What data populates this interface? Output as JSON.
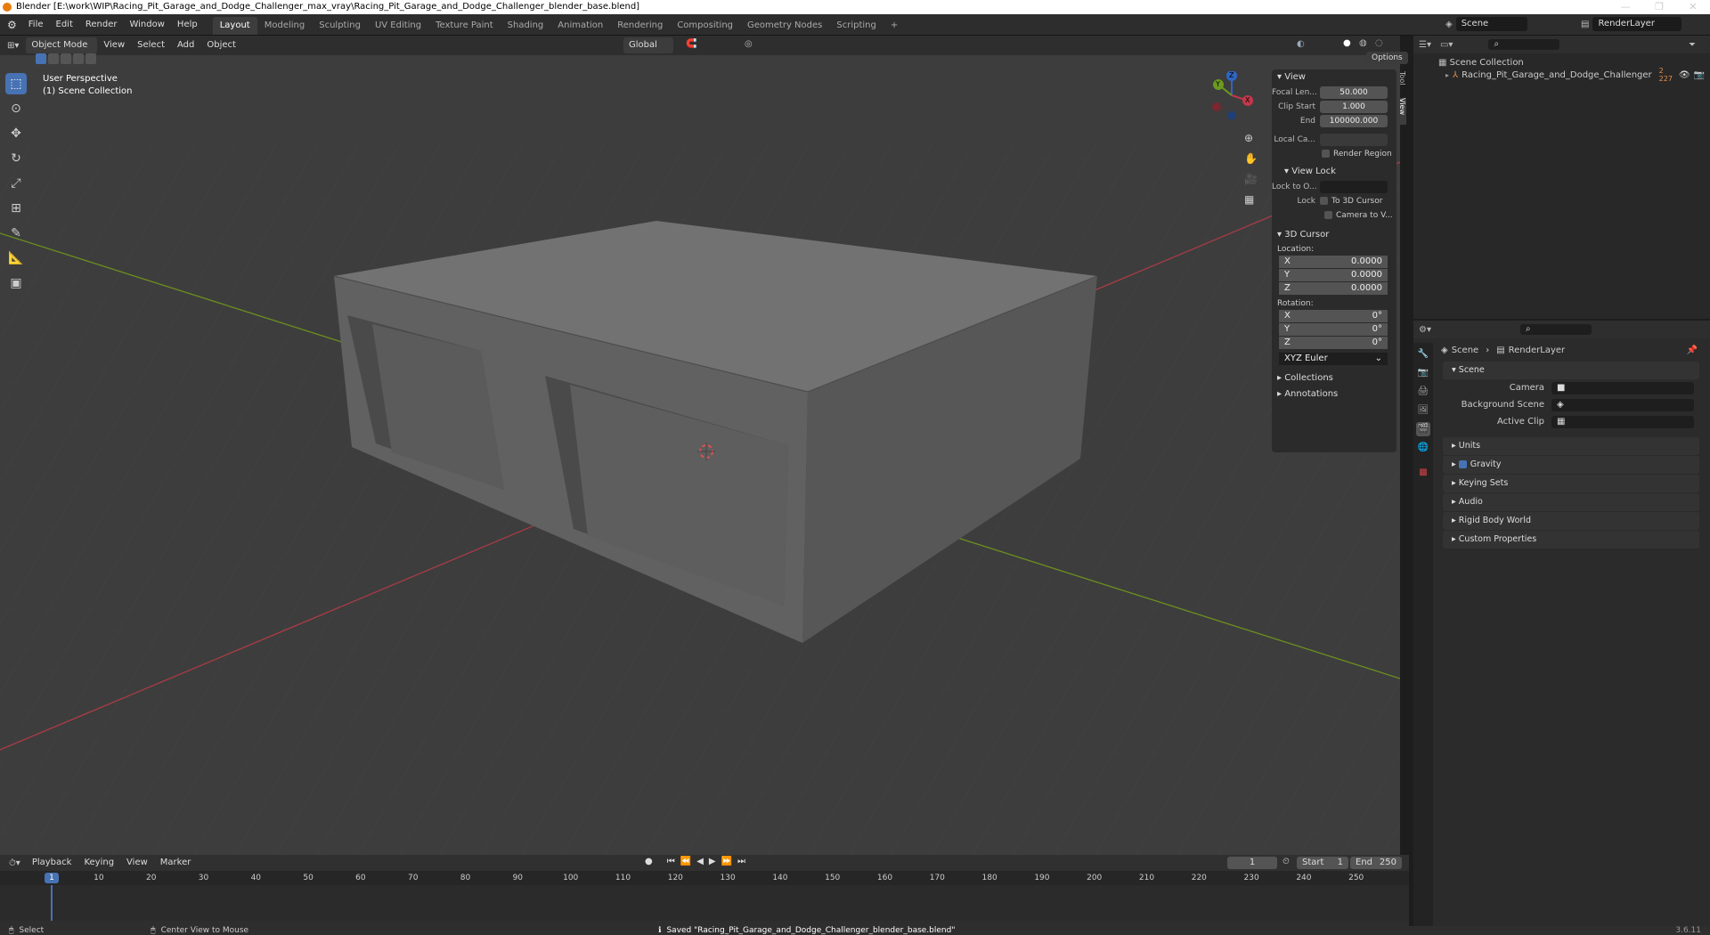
{
  "title_bar": {
    "title": "Blender [E:\\work\\WIP\\Racing_Pit_Garage_and_Dodge_Challenger_max_vray\\Racing_Pit_Garage_and_Dodge_Challenger_blender_base.blend]",
    "controls": [
      "—",
      "❐",
      "✕"
    ]
  },
  "menus": [
    "File",
    "Edit",
    "Render",
    "Window",
    "Help"
  ],
  "workspaces": [
    {
      "label": "Layout",
      "active": true
    },
    {
      "label": "Modeling"
    },
    {
      "label": "Sculpting"
    },
    {
      "label": "UV Editing"
    },
    {
      "label": "Texture Paint"
    },
    {
      "label": "Shading"
    },
    {
      "label": "Animation"
    },
    {
      "label": "Rendering"
    },
    {
      "label": "Compositing"
    },
    {
      "label": "Geometry Nodes"
    },
    {
      "label": "Scripting"
    }
  ],
  "add_workspace": "+",
  "scene_name": "Scene",
  "view_layer_name": "RenderLayer",
  "viewport_header": {
    "mode": "Object Mode",
    "menus": [
      "View",
      "Select",
      "Add",
      "Object"
    ],
    "transform_orientation": "Global",
    "options_label": "Options"
  },
  "viewport": {
    "perspective": "User Perspective",
    "collection": "(1) Scene Collection",
    "background": "#3d3d3d",
    "axis_x_color": "#a83c45",
    "axis_y_color": "#6c8f1f"
  },
  "gizmo": {
    "x": "X",
    "y": "Y",
    "z": "Z"
  },
  "tools": [
    {
      "icon": "select-box-icon",
      "active": true
    },
    {
      "icon": "cursor-icon"
    },
    {
      "icon": "move-icon"
    },
    {
      "icon": "rotate-icon"
    },
    {
      "icon": "scale-icon"
    },
    {
      "icon": "transform-icon"
    },
    {
      "icon": "annotate-icon"
    },
    {
      "icon": "measure-icon"
    },
    {
      "icon": "add-cube-icon"
    }
  ],
  "npanel": {
    "tabs": [
      "Tool",
      "View"
    ],
    "view_header": "View",
    "focal_length": {
      "label": "Focal Len...",
      "value": "50.000"
    },
    "clip_start": {
      "label": "Clip Start",
      "value": "1.000"
    },
    "clip_end": {
      "label": "End",
      "value": "100000.000"
    },
    "local_camera": "Local Ca...",
    "render_region": "Render Region",
    "view_lock_header": "View Lock",
    "lock_to_object": "Lock to O...",
    "lock_label": "Lock",
    "to_3d_cursor": "To 3D Cursor",
    "camera_to_view": "Camera to V...",
    "cursor_header": "3D Cursor",
    "location_label": "Location:",
    "location": [
      {
        "axis": "X",
        "value": "0.0000"
      },
      {
        "axis": "Y",
        "value": "0.0000"
      },
      {
        "axis": "Z",
        "value": "0.0000"
      }
    ],
    "rotation_label": "Rotation:",
    "rotation": [
      {
        "axis": "X",
        "value": "0°"
      },
      {
        "axis": "Y",
        "value": "0°"
      },
      {
        "axis": "Z",
        "value": "0°"
      }
    ],
    "rotation_mode": "XYZ Euler",
    "collections": "Collections",
    "annotations": "Annotations"
  },
  "outliner": {
    "root": "Scene Collection",
    "items": [
      {
        "name": "Racing_Pit_Garage_and_Dodge_Challenger",
        "badge": "2 227"
      }
    ]
  },
  "properties": {
    "breadcrumb": [
      "Scene",
      "RenderLayer"
    ],
    "scene_panel": "Scene",
    "camera_label": "Camera",
    "background_scene_label": "Background Scene",
    "active_clip_label": "Active Clip",
    "sections": [
      {
        "label": "Units"
      },
      {
        "label": "Gravity",
        "checkbox": true,
        "checked": true
      },
      {
        "label": "Keying Sets"
      },
      {
        "label": "Audio"
      },
      {
        "label": "Rigid Body World"
      },
      {
        "label": "Custom Properties"
      }
    ]
  },
  "timeline": {
    "menus": [
      "Playback",
      "Keying",
      "View",
      "Marker"
    ],
    "current_frame": "1",
    "start_label": "Start",
    "start": "1",
    "end_label": "End",
    "end": "250",
    "ticks": [
      "1",
      "10",
      "20",
      "30",
      "40",
      "50",
      "60",
      "70",
      "80",
      "90",
      "100",
      "110",
      "120",
      "130",
      "140",
      "150",
      "160",
      "170",
      "180",
      "190",
      "200",
      "210",
      "220",
      "230",
      "240",
      "250"
    ]
  },
  "status_bar": {
    "left_action": "Select",
    "middle_action": "Center View to Mouse",
    "message": "Saved \"Racing_Pit_Garage_and_Dodge_Challenger_blender_base.blend\"",
    "version": "3.6.11"
  }
}
